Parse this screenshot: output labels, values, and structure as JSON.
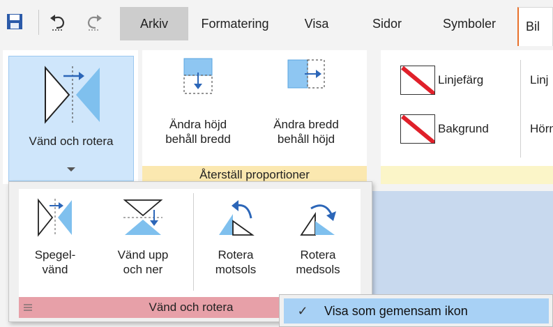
{
  "quick_access": {
    "save_icon": "save-icon",
    "undo_icon": "undo-icon",
    "redo_icon": "redo-icon"
  },
  "tabs": [
    {
      "label": "Arkiv"
    },
    {
      "label": "Formatering"
    },
    {
      "label": "Visa"
    },
    {
      "label": "Sidor"
    },
    {
      "label": "Symboler"
    },
    {
      "label": "Bil"
    }
  ],
  "ribbon": {
    "flip_rotate": {
      "label": "Vänd och rotera"
    },
    "reset_group": {
      "change_height": "Ändra höjd\nbehåll bredd",
      "change_width": "Ändra bredd\nbehåll höjd",
      "label": "Återställ proportioner"
    },
    "style_group": {
      "line_color": "Linjefärg",
      "background": "Bakgrund",
      "cut_top": "Linj",
      "cut_bottom": "Hörn"
    }
  },
  "panel": {
    "mirror": "Spegel-\nvänd",
    "flip_vertical": "Vänd upp\noch ner",
    "rotate_ccw": "Rotera\nmotsols",
    "rotate_cw": "Rotera\nmedsols",
    "label": "Vänd och rotera"
  },
  "context_menu": {
    "item": "Visa som gemensam ikon",
    "checked": true
  },
  "colors": {
    "accent_blue": "#3a8ee6",
    "selected_button": "#cfe6fb",
    "group_yellow": "#fbe8b0",
    "group_red": "#e7a0a8",
    "menu_hover": "#a8d1f5",
    "tab_orange": "#e8702a"
  }
}
